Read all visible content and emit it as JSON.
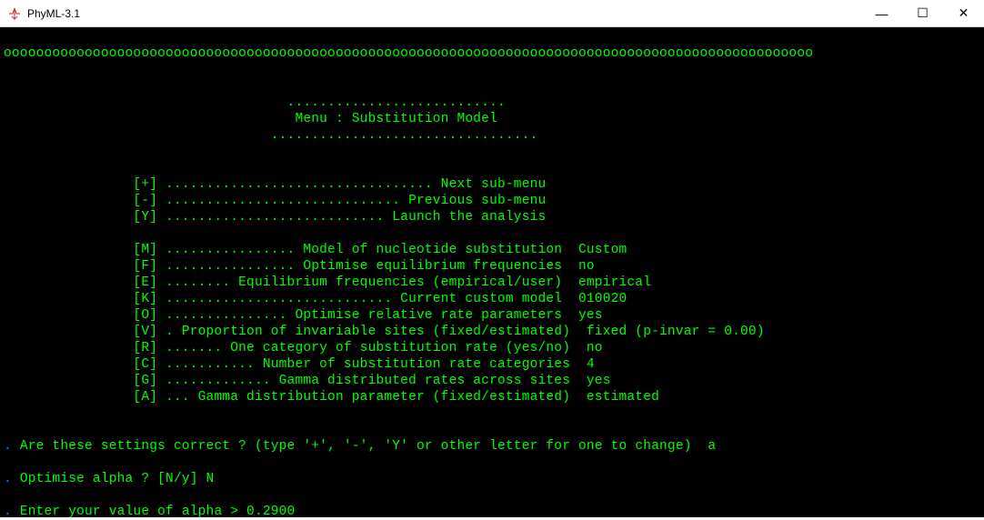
{
  "window": {
    "title": "PhyML-3.1",
    "minimize": "—",
    "maximize": "☐",
    "close": "✕"
  },
  "border_line": "oooooooooooooooooooooooooooooooooooooooooooooooooooooooooooooooooooooooooooooooooooooooooooooooooooo",
  "menu_dots_top": "                                   ...........................",
  "menu_title": "                                    Menu : Substitution Model",
  "menu_dots_bot": "                                 .................................",
  "nav": [
    {
      "key": "[+]",
      "dots": " ................................. ",
      "label": "Next sub-menu"
    },
    {
      "key": "[-]",
      "dots": " ............................. ",
      "label": "Previous sub-menu"
    },
    {
      "key": "[Y]",
      "dots": " ........................... ",
      "label": "Launch the analysis"
    }
  ],
  "params": [
    {
      "key": "[M]",
      "dots": " ................",
      "label": " Model of nucleotide substitution",
      "value": "  Custom"
    },
    {
      "key": "[F]",
      "dots": " ................",
      "label": " Optimise equilibrium frequencies",
      "value": "  no"
    },
    {
      "key": "[E]",
      "dots": " ........ ",
      "label": "Equilibrium frequencies (empirical/user)",
      "value": "  empirical"
    },
    {
      "key": "[K]",
      "dots": " ............................ ",
      "label": "Current custom model",
      "value": "  010020"
    },
    {
      "key": "[O]",
      "dots": " ............... ",
      "label": "Optimise relative rate parameters",
      "value": "  yes"
    },
    {
      "key": "[V]",
      "dots": " . ",
      "label": "Proportion of invariable sites (fixed/estimated)",
      "value": "  fixed (p-invar = 0.00)"
    },
    {
      "key": "[R]",
      "dots": " ....... ",
      "label": "One category of substitution rate (yes/no)",
      "value": "  no"
    },
    {
      "key": "[C]",
      "dots": " ........... ",
      "label": "Number of substitution rate categories",
      "value": "  4"
    },
    {
      "key": "[G]",
      "dots": " ............. ",
      "label": "Gamma distributed rates across sites",
      "value": "  yes"
    },
    {
      "key": "[A]",
      "dots": " ... ",
      "label": "Gamma distribution parameter (fixed/estimated)",
      "value": "  estimated"
    }
  ],
  "prompts": [
    {
      "prefix": ". ",
      "text": "Are these settings correct ? (type '+', '-', 'Y' or other letter for one to change)  a"
    },
    {
      "prefix": ". ",
      "text": "Optimise alpha ? [N/y] N"
    },
    {
      "prefix": ". ",
      "text": "Enter your value of alpha > 0.2900"
    }
  ]
}
